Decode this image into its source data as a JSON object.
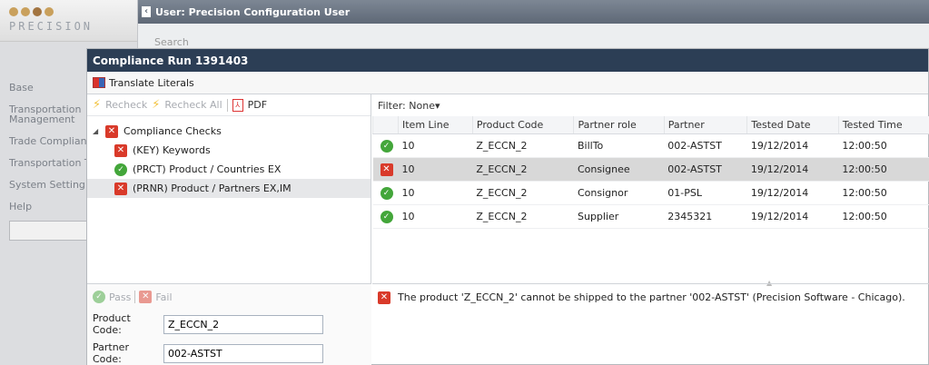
{
  "app": {
    "logo_text": "PRECISION",
    "nav": [
      "Base",
      "Transportation Management",
      "Trade Complian",
      "Transportation Tracking",
      "System Setting",
      "Help"
    ]
  },
  "window": {
    "title": "User: Precision Configuration User",
    "search_label": "Search"
  },
  "dialog": {
    "title": "Compliance Run 1391403",
    "translate_label": "Translate Literals",
    "recheck_label": "Recheck",
    "recheck_all_label": "Recheck All",
    "pdf_label": "PDF",
    "tree": {
      "root": "Compliance Checks",
      "children": [
        {
          "label": "(KEY) Keywords",
          "status": "fail"
        },
        {
          "label": "(PRCT) Product / Countries EX",
          "status": "pass"
        },
        {
          "label": "(PRNR) Product / Partners EX,IM",
          "status": "fail"
        }
      ]
    },
    "pass_label": "Pass",
    "fail_label": "Fail",
    "product_code_label": "Product Code:",
    "product_code_value": "Z_ECCN_2",
    "partner_code_label": "Partner Code:",
    "partner_code_value": "002-ASTST",
    "filter_label": "Filter:",
    "filter_value": "None",
    "columns": [
      "Item Line",
      "Product Code",
      "Partner role",
      "Partner",
      "Tested Date",
      "Tested Time"
    ],
    "rows": [
      {
        "status": "pass",
        "item_line": "10",
        "product_code": "Z_ECCN_2",
        "partner_role": "BillTo",
        "partner": "002-ASTST",
        "tested_date": "19/12/2014",
        "tested_time": "12:00:50"
      },
      {
        "status": "fail",
        "item_line": "10",
        "product_code": "Z_ECCN_2",
        "partner_role": "Consignee",
        "partner": "002-ASTST",
        "tested_date": "19/12/2014",
        "tested_time": "12:00:50"
      },
      {
        "status": "pass",
        "item_line": "10",
        "product_code": "Z_ECCN_2",
        "partner_role": "Consignor",
        "partner": "01-PSL",
        "tested_date": "19/12/2014",
        "tested_time": "12:00:50"
      },
      {
        "status": "pass",
        "item_line": "10",
        "product_code": "Z_ECCN_2",
        "partner_role": "Supplier",
        "partner": "2345321",
        "tested_date": "19/12/2014",
        "tested_time": "12:00:50"
      }
    ],
    "message": "The product 'Z_ECCN_2' cannot be shipped to the partner '002-ASTST' (Precision Software - Chicago)."
  }
}
